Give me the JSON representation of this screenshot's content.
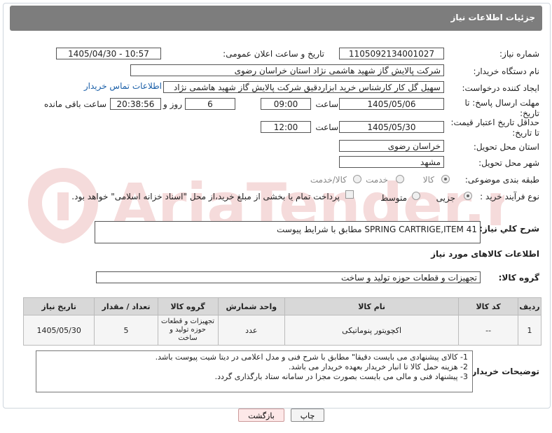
{
  "header": {
    "title": "جزئیات اطلاعات نیاز"
  },
  "fields": {
    "need_number_label": "شماره نیاز:",
    "need_number": "1105092134001027",
    "announce_label": "تاریخ و ساعت اعلان عمومی:",
    "announce_value": "1405/04/30 - 10:57",
    "buyer_org_label": "نام دستگاه خریدار:",
    "buyer_org": "شرکت پالایش گاز شهید هاشمی نژاد   استان خراسان رضوی",
    "creator_label": "ایجاد کننده درخواست:",
    "creator": "سهیل گل کار کارشناس خرید ابزاردقیق شرکت پالایش گاز شهید هاشمی نژاد",
    "contact_link": "اطلاعات تماس خریدار",
    "deadline_label": "مهلت ارسال پاسخ: تا تاریخ:",
    "deadline_date": "1405/05/06",
    "time_label": "ساعت",
    "deadline_time": "09:00",
    "days_value": "6",
    "days_label": "روز و",
    "remaining_time": "20:38:56",
    "remaining_label": "ساعت باقی مانده",
    "validity_label": "حداقل تاریخ اعتبار قیمت: تا تاریخ:",
    "validity_date": "1405/05/30",
    "validity_time": "12:00",
    "province_label": "استان محل تحویل:",
    "province": "خراسان رضوی",
    "city_label": "شهر محل تحویل:",
    "city": "مشهد",
    "category_label": "طبقه بندی موضوعی:",
    "category_options": [
      "کالا",
      "خدمت",
      "کالا/خدمت"
    ],
    "process_label": "نوع فرآیند خرید :",
    "process_options": [
      "جزیی",
      "متوسط"
    ],
    "payment_note": "پرداخت تمام یا بخشی از مبلغ خرید،از محل \"اسناد خزانه اسلامی\" خواهد بود."
  },
  "description": {
    "label": "شرح کلي نياز:",
    "text": "SPRING CARTRIGE,ITEM 41 مطابق با شرایط پیوست"
  },
  "goods": {
    "section_title": "اطلاعات کالاهای مورد نیاز",
    "group_label": "گروه کالا:",
    "group_value": "تجهیزات و قطعات حوزه تولید و ساخت",
    "columns": [
      "ردیف",
      "کد کالا",
      "نام کالا",
      "واحد شمارش",
      "گروه کالا",
      "تعداد / مقدار",
      "تاریخ نیاز"
    ],
    "rows": [
      {
        "row": "1",
        "code": "--",
        "name": "اکچویتور پنوماتیکی",
        "unit": "عدد",
        "group": "تجهیزات و قطعات حوزه تولید و ساخت",
        "qty": "5",
        "date": "1405/05/30"
      }
    ]
  },
  "notes": {
    "label": "توضیحات خریدار:",
    "lines": [
      "1-    کالای پیشنهادی می بایست دقیقا\" مطابق با شرح فنی و مدل اعلامی در دیتا شیت پیوست باشد.",
      "2-    هزینه حمل کالا تا انبار خریدار بعهده خریدار می باشد.",
      "3-    پیشنهاد فنی و مالی می بایست بصورت مجزا در سامانه ستاد بارگذاری گردد."
    ]
  },
  "buttons": {
    "print": "چاپ",
    "back": "بازگشت"
  },
  "watermark": {
    "text": "AriaTender.net"
  }
}
